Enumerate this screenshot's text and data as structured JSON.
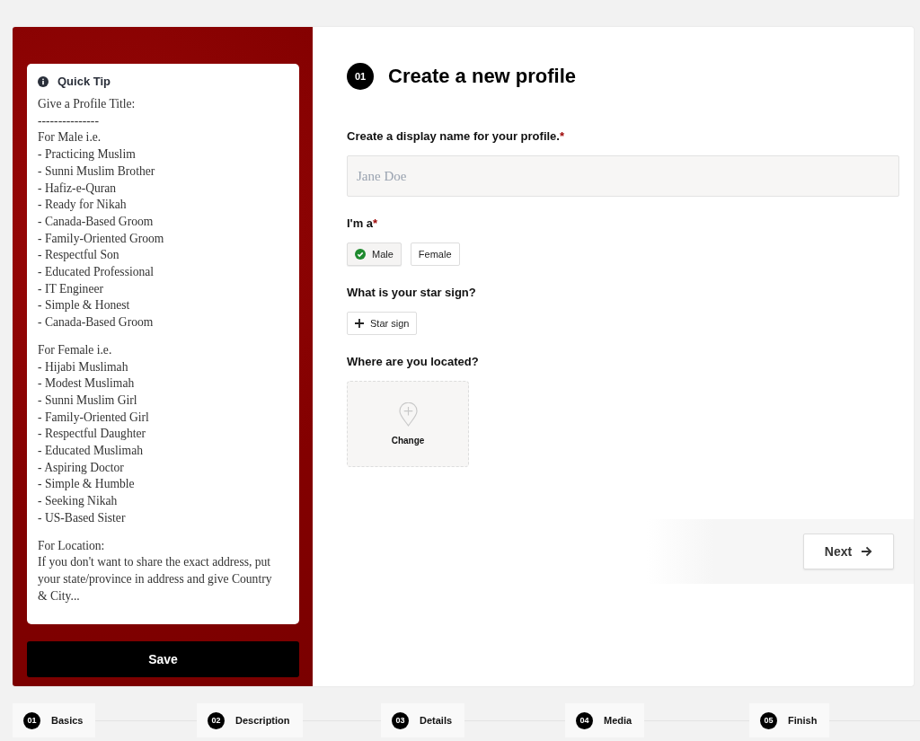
{
  "tip": {
    "title": "Quick Tip",
    "paragraphs": [
      {
        "lines": [
          "Give a Profile Title:",
          "---------------",
          "For Male i.e.",
          "- Practicing Muslim",
          "- Sunni Muslim Brother",
          "- Hafiz-e-Quran",
          "- Ready for Nikah",
          "- Canada-Based Groom",
          "- Family-Oriented Groom",
          "- Respectful Son",
          "- Educated Professional",
          "- IT Engineer",
          "- Simple & Honest",
          "- Canada-Based Groom"
        ]
      },
      {
        "lines": [
          "For Female i.e.",
          "- Hijabi Muslimah",
          "- Modest Muslimah",
          "- Sunni Muslim Girl",
          "- Family-Oriented Girl",
          "- Respectful Daughter",
          "- Educated Muslimah",
          "- Aspiring Doctor",
          "- Simple & Humble",
          "- Seeking Nikah",
          "- US-Based Sister"
        ]
      },
      {
        "lines": [
          "For Location:",
          "If you don't want to share the exact address, put your state/province in address and give Country & City..."
        ]
      }
    ]
  },
  "save_button": "Save",
  "step_number": "01",
  "title": "Create a new profile",
  "fields": [
    {
      "kind": "text",
      "label": "Create a display name for your profile.",
      "required_mark": "*",
      "placeholder": "Jane Doe"
    },
    {
      "kind": "choice",
      "label": "I'm a",
      "required_mark": "*",
      "options": [
        {
          "label": "Male",
          "selected": true
        },
        {
          "label": "Female",
          "selected": false
        }
      ]
    },
    {
      "kind": "add",
      "label": "What is your star sign?",
      "button": "Star sign"
    },
    {
      "kind": "location",
      "label": "Where are you located?",
      "button": "Change"
    }
  ],
  "next_button": "Next",
  "steps": [
    {
      "number": "01",
      "label": "Basics"
    },
    {
      "number": "02",
      "label": "Description"
    },
    {
      "number": "03",
      "label": "Details"
    },
    {
      "number": "04",
      "label": "Media"
    },
    {
      "number": "05",
      "label": "Finish"
    }
  ]
}
